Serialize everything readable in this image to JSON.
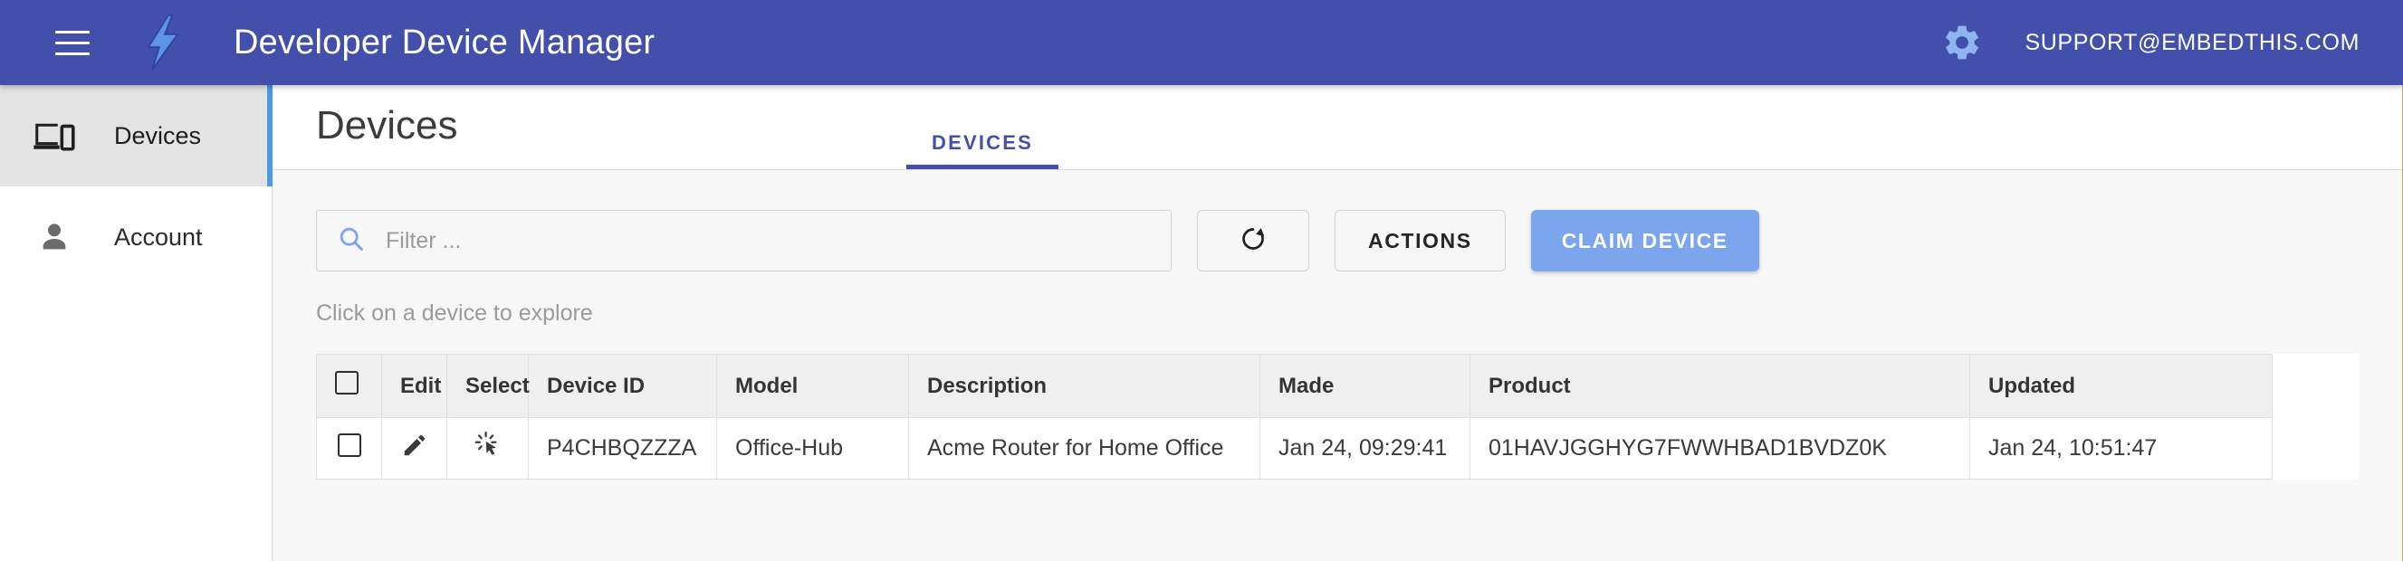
{
  "appbar": {
    "menu_icon": "hamburger-menu-icon",
    "logo_icon": "lightning-bolt-logo",
    "title": "Developer Device Manager",
    "gear_icon": "gear-icon",
    "user_email": "SUPPORT@EMBEDTHIS.COM",
    "background_color": "#4350ab",
    "text_color": "#ffffff",
    "logo_color": "#5b95e8"
  },
  "sidebar": {
    "items": [
      {
        "label": "Devices",
        "icon": "devices-icon",
        "active": true
      },
      {
        "label": "Account",
        "icon": "person-icon",
        "active": false
      }
    ],
    "active_indicator_color": "#4a9ae8",
    "active_background": "#e3e3e3"
  },
  "page": {
    "title": "Devices",
    "tabs": [
      {
        "label": "DEVICES",
        "active": true
      }
    ],
    "tab_accent_color": "#4350ab"
  },
  "toolbar": {
    "filter_placeholder": "Filter ...",
    "filter_value": "",
    "search_icon": "search-icon",
    "refresh_icon": "refresh-icon",
    "actions_label": "ACTIONS",
    "claim_device_label": "CLAIM DEVICE",
    "primary_button_color": "#7ba6ee"
  },
  "hint_text": "Click on a device to explore",
  "table": {
    "columns": [
      {
        "key": "check",
        "label": "",
        "icon": "checkbox-icon"
      },
      {
        "key": "edit",
        "label": "Edit"
      },
      {
        "key": "select",
        "label": "Select"
      },
      {
        "key": "device_id",
        "label": "Device ID"
      },
      {
        "key": "model",
        "label": "Model"
      },
      {
        "key": "description",
        "label": "Description"
      },
      {
        "key": "made",
        "label": "Made"
      },
      {
        "key": "product",
        "label": "Product"
      },
      {
        "key": "updated",
        "label": "Updated"
      }
    ],
    "rows": [
      {
        "checked": false,
        "edit_icon": "pencil-edit-icon",
        "select_icon": "click-cursor-icon",
        "device_id": "P4CHBQZZZA",
        "model": "Office-Hub",
        "description": "Acme Router for Home Office",
        "made": "Jan 24, 09:29:41",
        "product": "01HAVJGGHYG7FWWHBAD1BVDZ0K",
        "updated": "Jan 24, 10:51:47"
      }
    ]
  }
}
